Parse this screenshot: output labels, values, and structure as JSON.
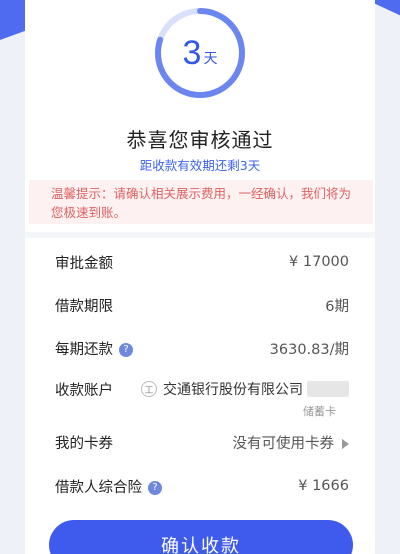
{
  "countdown": {
    "number": "3",
    "unit": "天",
    "progress": 0.8
  },
  "title": "恭喜您审核通过",
  "subtitle": "距收款有效期还剩3天",
  "notice": {
    "label": "温馨提示：",
    "text": "请确认相关展示费用，一经确认，我们将为您极速到账。"
  },
  "rows": {
    "amount": {
      "label": "审批金额",
      "value": "¥ 17000"
    },
    "term": {
      "label": "借款期限",
      "value": "6期"
    },
    "repayment": {
      "label": "每期还款",
      "value": "3630.83/期"
    },
    "account": {
      "label": "收款账户",
      "bank": "交通银行股份有限公司",
      "card_type": "储蓄卡"
    },
    "coupon": {
      "label": "我的卡券",
      "value": "没有可使用卡券"
    },
    "insurance": {
      "label": "借款人综合险",
      "value": "¥ 1666"
    }
  },
  "confirm_label": "确认收款",
  "colors": {
    "accent": "#3f5bee",
    "notice_text": "#e06262"
  }
}
